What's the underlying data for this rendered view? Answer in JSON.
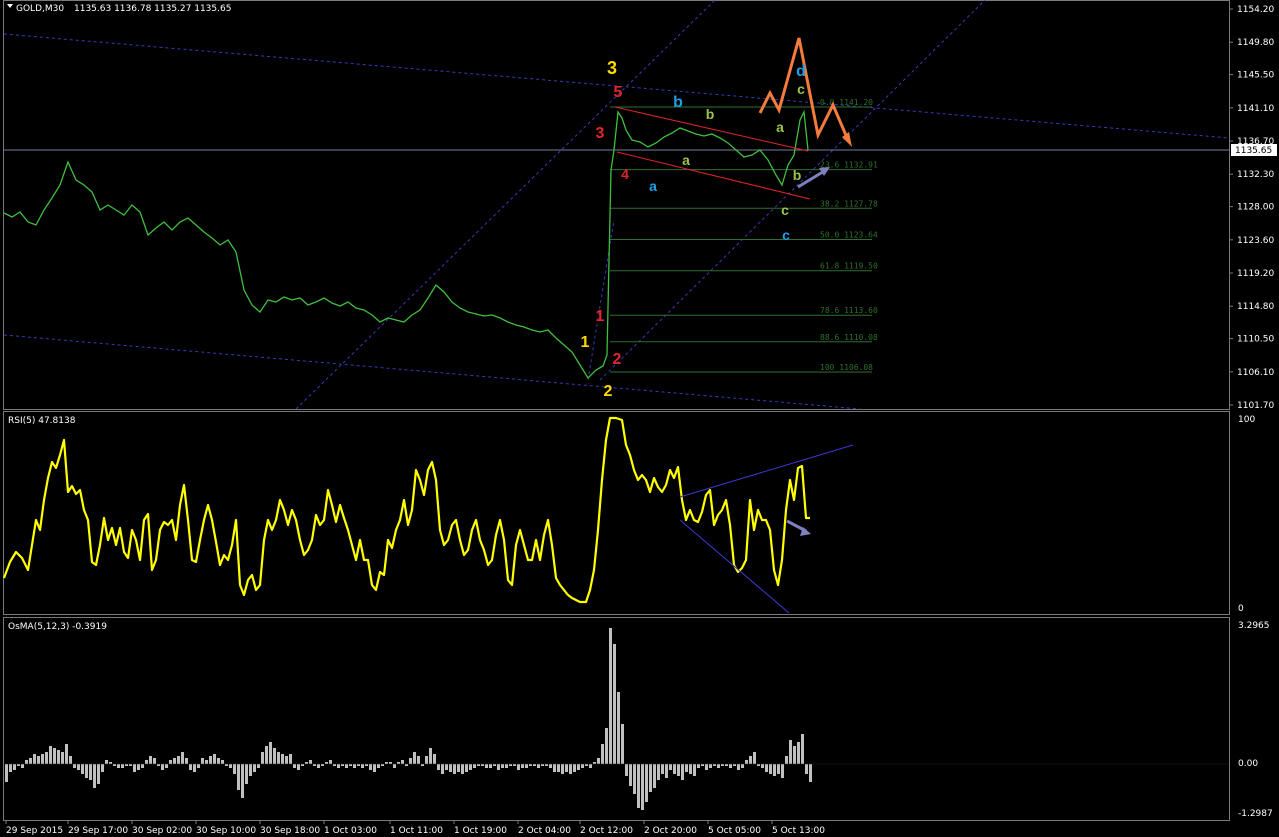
{
  "header": {
    "symbol_label": "GOLD,M30",
    "ohlc": "1135.63 1136.78 1135.27 1135.65"
  },
  "price_scale": {
    "ticks": [
      "1154.20",
      "1149.80",
      "1145.50",
      "1141.10",
      "1136.70",
      "1132.30",
      "1128.00",
      "1123.60",
      "1119.20",
      "1114.80",
      "1110.50",
      "1106.10",
      "1101.70"
    ],
    "current_price": "1135.65"
  },
  "fibonacci": {
    "levels": [
      {
        "label": "0.0",
        "value": "1141.20"
      },
      {
        "label": "23.6",
        "value": "1132.91"
      },
      {
        "label": "38.2",
        "value": "1127.78"
      },
      {
        "label": "50.0",
        "value": "1123.64"
      },
      {
        "label": "61.8",
        "value": "1119.50"
      },
      {
        "label": "78.6",
        "value": "1113.60"
      },
      {
        "label": "88.6",
        "value": "1110.08"
      },
      {
        "label": "100",
        "value": "1106.08"
      }
    ],
    "color": "#2f6f2f"
  },
  "wave_labels": {
    "yellow": [
      "1",
      "2",
      "3"
    ],
    "red": [
      "1",
      "2",
      "3",
      "4",
      "5"
    ],
    "blue": [
      "a",
      "b",
      "c",
      "d"
    ],
    "green": [
      "a",
      "b",
      "c",
      "a",
      "b",
      "c"
    ],
    "colors": {
      "yellow": "#ffd900",
      "red": "#e0262b",
      "blue": "#1ea0e8",
      "green": "#9bc44a",
      "orange": "#f47c3c",
      "arrow": "#8080c0"
    }
  },
  "rsi": {
    "label": "RSI(5) 47.8138",
    "scale_top": "100",
    "scale_bottom": "0",
    "color": "#ffff00"
  },
  "osma": {
    "label": "OsMA(5,12,3) -0.3919",
    "scale_top": "3.2965",
    "scale_mid": "0.00",
    "scale_bottom": "-1.2987",
    "color": "#c0c0c0"
  },
  "time_axis": {
    "labels": [
      "29 Sep 2015",
      "29 Sep 17:00",
      "30 Sep 02:00",
      "30 Sep 10:00",
      "30 Sep 18:00",
      "1 Oct 03:00",
      "1 Oct 11:00",
      "1 Oct 19:00",
      "2 Oct 04:00",
      "2 Oct 12:00",
      "2 Oct 20:00",
      "5 Oct 05:00",
      "5 Oct 13:00"
    ]
  },
  "chart_data": {
    "type": "line",
    "symbol": "GOLD",
    "timeframe": "M30",
    "price_series_color": "#3fbf3f",
    "ylim": [
      1101.7,
      1154.2
    ],
    "x": [
      "29 Sep 2015",
      "29 Sep 17:00",
      "30 Sep 02:00",
      "30 Sep 10:00",
      "30 Sep 18:00",
      "1 Oct 03:00",
      "1 Oct 11:00",
      "1 Oct 19:00",
      "2 Oct 04:00",
      "2 Oct 12:00",
      "2 Oct 20:00",
      "5 Oct 05:00",
      "5 Oct 13:00"
    ],
    "close": [
      1129.0,
      1132.5,
      1129.5,
      1127.5,
      1116.5,
      1116.0,
      1114.0,
      1117.0,
      1113.5,
      1108.5,
      1138.0,
      1136.0,
      1135.65
    ],
    "rsi_range": [
      0,
      100
    ],
    "osma_range": [
      -1.2987,
      3.2965
    ]
  }
}
